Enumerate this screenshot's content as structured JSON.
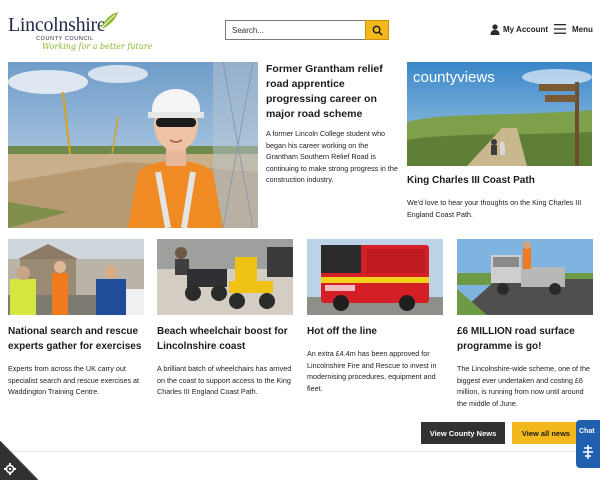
{
  "header": {
    "logo": {
      "name": "Lincolnshire",
      "subtitle": "COUNTY COUNCIL",
      "tagline": "Working for a better future"
    },
    "search": {
      "placeholder": "Search...",
      "button_icon": "search-icon"
    },
    "account_label": "My Account",
    "menu_label": "Menu"
  },
  "feature": {
    "title": "Former Grantham relief road apprentice progressing career on major road scheme",
    "summary": "A former Lincoln College student who began his career working on the Grantham Southern Relief Road is continuing to make strong progress in the construction industry."
  },
  "side_feature": {
    "image_text": "countyviews",
    "title": "King Charles III Coast Path",
    "summary": "We'd love to hear your thoughts on the King Charles III England Coast Path."
  },
  "cards": [
    {
      "title": "National search and rescue experts gather for exercises",
      "summary": "Experts from across the UK carry out specialist search and rescue exercises at Waddington Training Centre."
    },
    {
      "title": "Beach wheelchair boost for Lincolnshire coast",
      "summary": "A brilliant batch of wheelchairs has arrived on the coast to support access to the King Charles III England Coast Path."
    },
    {
      "title": "Hot off the line",
      "summary": "An extra £4.4m has been approved for Lincolnshire Fire and Rescue to invest in modernising procedures, equipment and fleet."
    },
    {
      "title": "£6 MILLION road surface programme is go!",
      "summary": "The Lincolnshire-wide scheme, one of the biggest ever undertaken and costing £6 million, is running from now until around the middle of June."
    }
  ],
  "actions": {
    "county_news": "View County News",
    "all_news": "View all news"
  },
  "chat": {
    "label": "Chat"
  },
  "colors": {
    "accent_yellow": "#f2b81c",
    "dark_button": "#2f3133",
    "chat_blue": "#1f5fae",
    "logo_green": "#8cb82b"
  }
}
